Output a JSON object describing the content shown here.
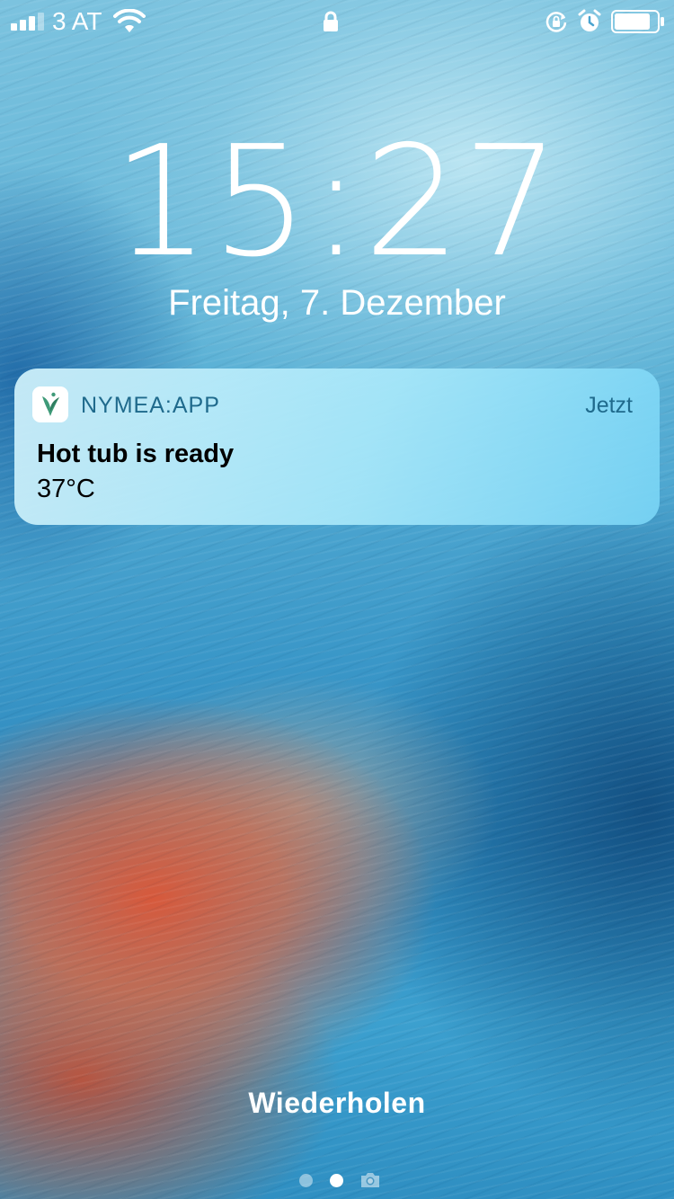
{
  "status_bar": {
    "carrier": "3 AT",
    "signal_bars_active": 3,
    "signal_bars_total": 4,
    "icons": [
      "signal-icon",
      "wifi-icon",
      "lock-icon",
      "rotation-lock-icon",
      "alarm-icon",
      "battery-icon"
    ],
    "battery_level": 0.85
  },
  "lock_screen": {
    "time": "15:27",
    "date": "Freitag, 7. Dezember"
  },
  "notification": {
    "app_name": "NYMEA:APP",
    "timestamp": "Jetzt",
    "title": "Hot tub is ready",
    "body": "37°C",
    "app_icon": "nymea-bird-icon",
    "accent_color": "#1f6a8c"
  },
  "bottom": {
    "hint_label": "Wiederholen",
    "page_indicator": {
      "count": 2,
      "active_index": 1,
      "trailing_icon": "camera-icon"
    }
  }
}
